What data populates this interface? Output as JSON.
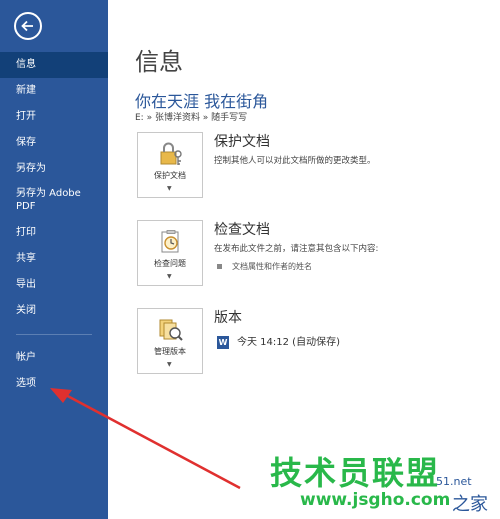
{
  "sidebar": {
    "items": [
      {
        "label": "信息"
      },
      {
        "label": "新建"
      },
      {
        "label": "打开"
      },
      {
        "label": "保存"
      },
      {
        "label": "另存为"
      },
      {
        "label": "另存为 Adobe PDF"
      },
      {
        "label": "打印"
      },
      {
        "label": "共享"
      },
      {
        "label": "导出"
      },
      {
        "label": "关闭"
      },
      {
        "label": "帐户"
      },
      {
        "label": "选项"
      }
    ],
    "active_index": 0
  },
  "main": {
    "title": "信息",
    "document_title": "你在天涯 我在街角",
    "path": "E: » 张博洋资料 » 随手写写",
    "sections": [
      {
        "tile_label": "保护文档",
        "heading": "保护文档",
        "description": "控制其他人可以对此文档所做的更改类型。",
        "icon": "lock-key-icon"
      },
      {
        "tile_label": "检查问题",
        "heading": "检查文档",
        "description": "在发布此文件之前，请注意其包含以下内容:",
        "bullet": "文档属性和作者的姓名",
        "icon": "inspect-icon"
      },
      {
        "tile_label": "管理版本",
        "heading": "版本",
        "version_entry": "今天 14:12 (自动保存)",
        "icon": "manage-versions-icon"
      }
    ]
  },
  "watermark": {
    "text": "技术员联盟",
    "url": "www.jsgho.com",
    "frag1": "51.net",
    "frag2": "之家"
  },
  "colors": {
    "sidebar": "#2b579a",
    "sidebar_active": "#124078",
    "accent": "#2b579a",
    "arrow": "#e0302f",
    "watermark": "#29b84a"
  }
}
